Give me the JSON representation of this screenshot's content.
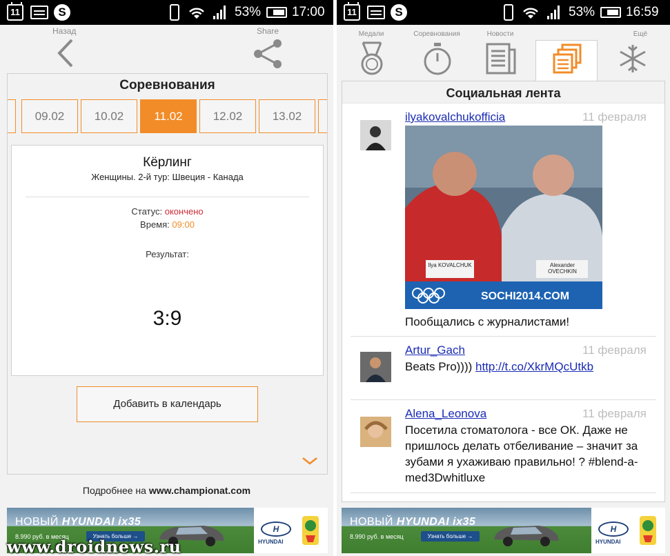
{
  "left": {
    "status": {
      "battery": "53%",
      "time": "17:00",
      "cal_day": "11"
    },
    "topbar": {
      "back_label": "Назад",
      "share_label": "Share"
    },
    "panel_title": "Соревнования",
    "dates": [
      "09.02",
      "10.02",
      "11.02",
      "12.02",
      "13.02"
    ],
    "active_date": "11.02",
    "event": {
      "sport": "Кёрлинг",
      "subtitle": "Женщины. 2-й тур: Швеция - Канада",
      "status_label": "Статус:",
      "status_value": "окончено",
      "time_label": "Время:",
      "time_value": "09:00",
      "result_label": "Результат:",
      "score": "3:9"
    },
    "calendar_button": "Добавить в календарь",
    "footer_prefix": "Подробнее на",
    "footer_site": "www.championat.com"
  },
  "right": {
    "status": {
      "battery": "53%",
      "time": "16:59",
      "cal_day": "11"
    },
    "nav": [
      {
        "label": "Медали",
        "icon": "medal-icon"
      },
      {
        "label": "Соревнования",
        "icon": "stopwatch-icon"
      },
      {
        "label": "Новости",
        "icon": "newspaper-icon"
      },
      {
        "label": "",
        "icon": "social-feed-icon"
      },
      {
        "label": "Ещё",
        "icon": "snowflake-icon"
      }
    ],
    "feed_title": "Социальная лента",
    "posts": [
      {
        "user": "ilyakovalchukofficia",
        "date": "11 февраля",
        "text": "Пообщались с журналистами!",
        "photo_caption": "SOCHI2014.COM",
        "plate1": "Ilya KOVALCHUK",
        "plate2": "Alexander OVECHKIN"
      },
      {
        "user": "Artur_Gach",
        "date": "11 февраля",
        "text": "Beats Pro))))",
        "link": "http://t.co/XkrMQcUtkb"
      },
      {
        "user": "Alena_Leonova",
        "date": "11 февраля",
        "text": "Посетила стоматолога - все ОК. Даже не пришлось делать отбеливание – значит за зубами я ухаживаю правильно! ? #blend-a-med3Dwhitluxe"
      }
    ]
  },
  "ad": {
    "title_prefix": "НОВЫЙ",
    "title_brand": "HYUNDAI ix35",
    "price": "8.990 руб. в месяц",
    "button": "Узнать больше →",
    "brand": "HYUNDAI"
  },
  "watermark": "www.droidnews.ru",
  "colors": {
    "accent": "#f28c28",
    "status_red": "#cc2a36",
    "link": "#1a2bb5"
  }
}
